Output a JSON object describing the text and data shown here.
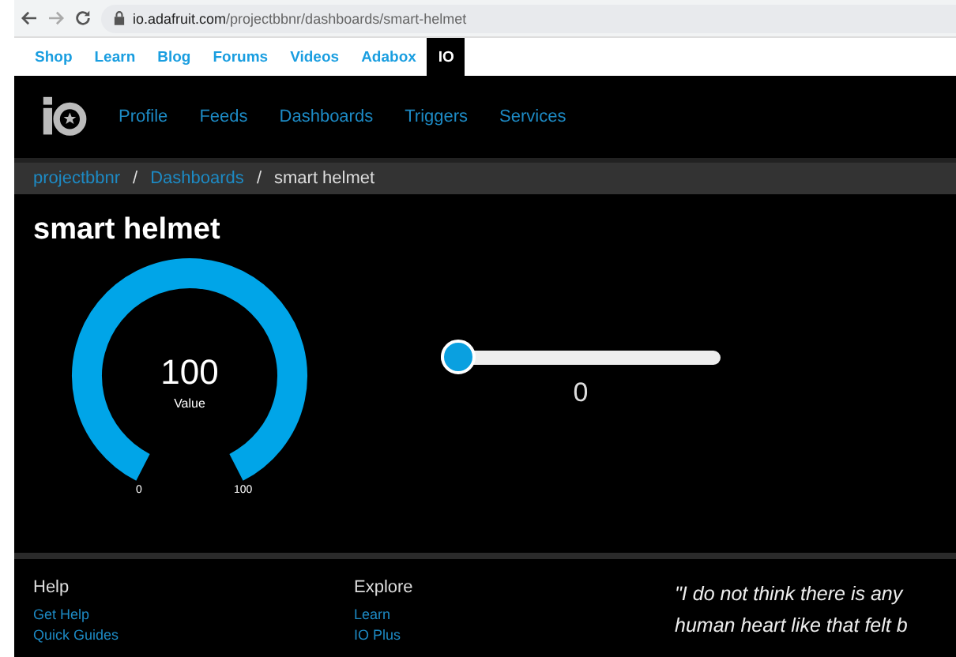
{
  "browser": {
    "url_host": "io.adafruit.com",
    "url_path": "/projectbbnr/dashboards/smart-helmet"
  },
  "site_nav": [
    {
      "label": "Shop",
      "selected": false
    },
    {
      "label": "Learn",
      "selected": false
    },
    {
      "label": "Blog",
      "selected": false
    },
    {
      "label": "Forums",
      "selected": false
    },
    {
      "label": "Videos",
      "selected": false
    },
    {
      "label": "Adabox",
      "selected": false
    },
    {
      "label": "IO",
      "selected": true
    }
  ],
  "io_nav": [
    "Profile",
    "Feeds",
    "Dashboards",
    "Triggers",
    "Services"
  ],
  "breadcrumb": [
    {
      "label": "projectbbnr",
      "kind": "link"
    },
    {
      "label": "/",
      "kind": "separator"
    },
    {
      "label": "Dashboards",
      "kind": "link"
    },
    {
      "label": "/",
      "kind": "separator"
    },
    {
      "label": "smart helmet",
      "kind": "current"
    }
  ],
  "dashboard": {
    "title": "smart helmet",
    "gauge": {
      "value": "100",
      "label": "Value",
      "min": "0",
      "max": "100"
    },
    "slider": {
      "value": "0",
      "level": 0
    }
  },
  "footer": {
    "columns": [
      {
        "heading": "Help",
        "links": [
          "Get Help",
          "Quick Guides"
        ]
      },
      {
        "heading": "Explore",
        "links": [
          "Learn",
          "IO Plus"
        ]
      }
    ],
    "quote_lines": [
      "\"I do not think there is any",
      "human heart like that felt b"
    ]
  }
}
